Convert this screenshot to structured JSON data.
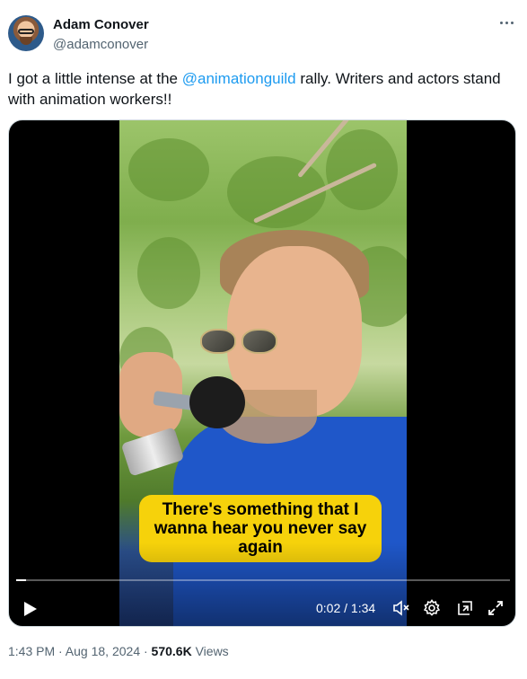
{
  "author": {
    "name": "Adam Conover",
    "handle": "@adamconover"
  },
  "tweet": {
    "text_before": "I got a little intense at the ",
    "mention": "@animationguild",
    "text_after": " rally. Writers and actors stand with animation workers!!"
  },
  "video": {
    "caption": "There's something that I wanna hear you never say again",
    "time_display": "0:02 / 1:34",
    "progress_fraction": 0.02
  },
  "meta": {
    "timestamp": "1:43 PM · Aug 18, 2024 · ",
    "views_count": "570.6K",
    "views_label": " Views"
  },
  "icons": {
    "more": "more-icon",
    "play": "play-icon",
    "mute": "mute-icon",
    "settings": "gear-icon",
    "pip": "picture-in-picture-icon",
    "fullscreen": "fullscreen-icon"
  },
  "colors": {
    "accent": "#1d9bf0",
    "caption_bg": "#f6d20b"
  }
}
